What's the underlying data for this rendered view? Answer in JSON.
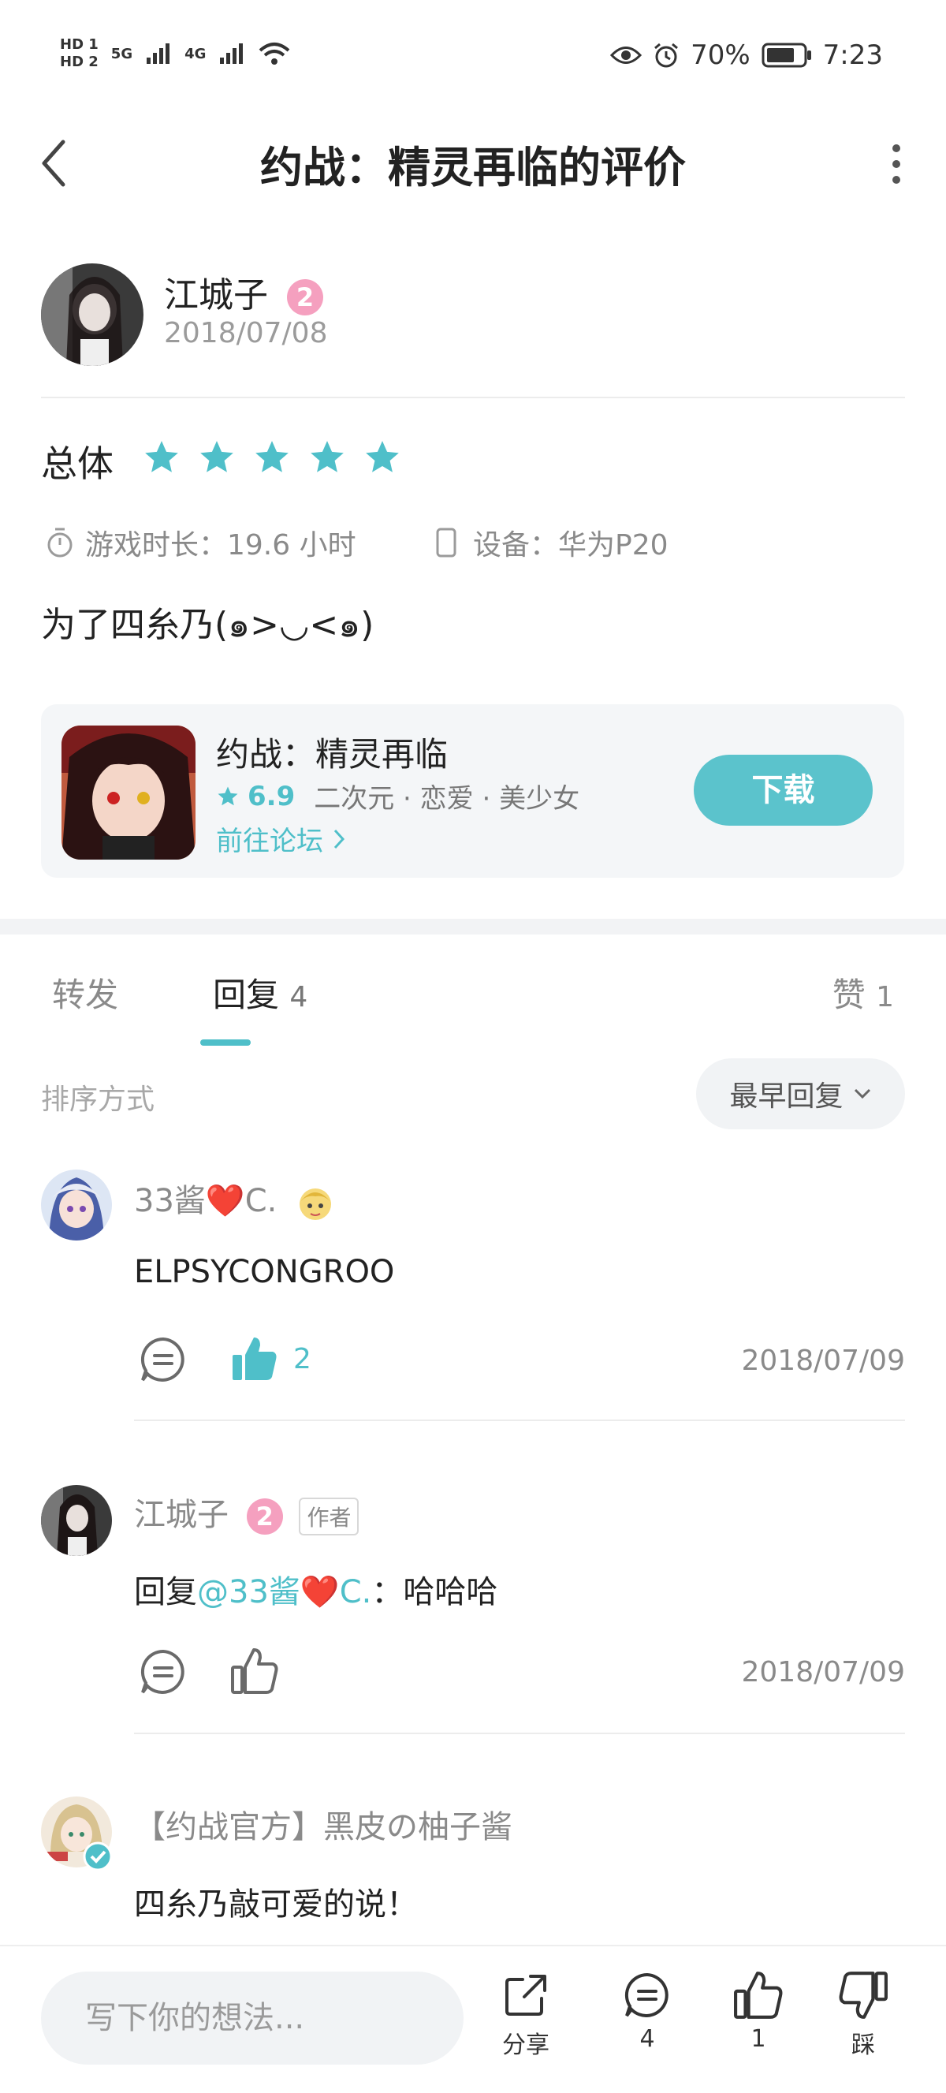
{
  "status_bar": {
    "hd1": "HD 1",
    "hd2": "HD 2",
    "net1": "5G",
    "net2": "4G",
    "battery": "70%",
    "time": "7:23"
  },
  "header": {
    "title": "约战：精灵再临的评价"
  },
  "review": {
    "author": "江城子",
    "author_level": "2",
    "date": "2018/07/08",
    "overall_label": "总体",
    "stars": 5,
    "playtime": "游戏时长：19.6 小时",
    "device": "设备：华为P20",
    "text": "为了四糸乃(๑>◡<๑)"
  },
  "game_card": {
    "name": "约战：精灵再临",
    "score": "6.9",
    "tags": "二次元 · 恋爱 · 美少女",
    "forum_link": "前往论坛",
    "download": "下载"
  },
  "tabs": {
    "repost": "转发",
    "reply": "回复",
    "reply_count": "4",
    "like": "赞",
    "like_count": "1"
  },
  "sort": {
    "label": "排序方式",
    "value": "最早回复"
  },
  "comments": [
    {
      "name": "33酱❤️C.",
      "text": "ELPSYCONGROO",
      "likes": "2",
      "date": "2018/07/09"
    },
    {
      "name": "江城子",
      "level": "2",
      "tag": "作者",
      "reply_prefix": "回复",
      "mention": "@33酱❤️C.",
      "text": "：哈哈哈",
      "date": "2018/07/09"
    },
    {
      "name": "【约战官方】黑皮の柚子酱",
      "text": "四糸乃敲可爱的说！"
    }
  ],
  "bottom_bar": {
    "placeholder": "写下你的想法...",
    "share": "分享",
    "comments": "4",
    "likes": "1",
    "dislike": "踩"
  },
  "colors": {
    "accent": "#4fbfc9",
    "badge": "#f5a0bf",
    "like_active": "#4fbfc9"
  }
}
